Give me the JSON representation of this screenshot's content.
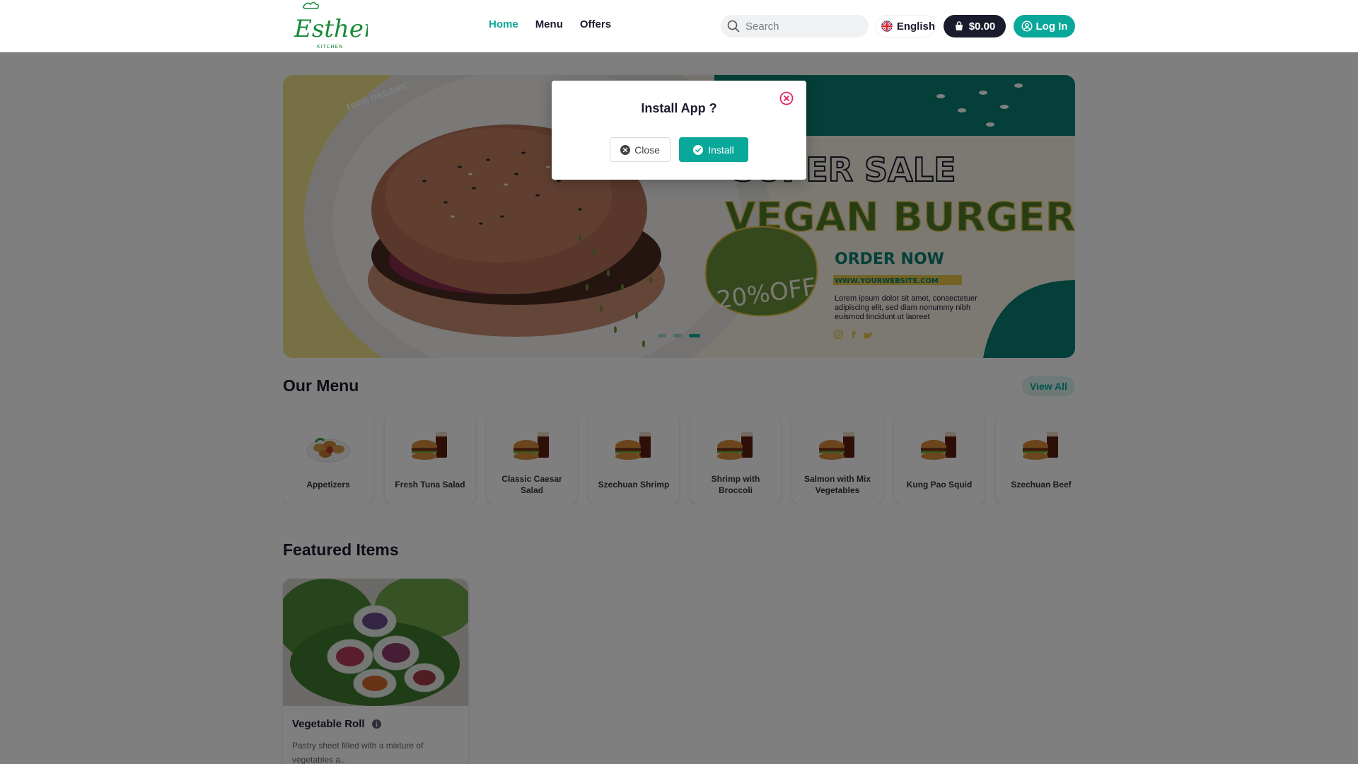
{
  "header": {
    "logo_text": "Esther's",
    "logo_subtext": "KITCHEN",
    "nav": [
      {
        "label": "Home",
        "active": true
      },
      {
        "label": "Menu",
        "active": false
      },
      {
        "label": "Offers",
        "active": false
      }
    ],
    "search_placeholder": "Search",
    "language": "English",
    "cart_total": "$0.00",
    "login_label": "Log In"
  },
  "banner": {
    "badge_text": "100% ORGANIC",
    "headline_1": "SUPER SALE",
    "headline_2": "VEGAN BURGER",
    "cta": "ORDER NOW",
    "website": "WWW.YOURWEBSITE.COM",
    "body_text": "Lorem ipsum dolor sit amet, consectetuer adipiscing elit, sed diam nonummy nibh euismod tincidunt ut laoreet",
    "discount": "20%OFF",
    "carousel_dots": 3,
    "active_dot": 3
  },
  "menu": {
    "title": "Our Menu",
    "view_all": "View All",
    "categories": [
      "Appetizers",
      "Fresh Tuna Salad",
      "Classic Caesar Salad",
      "Szechuan Shrimp",
      "Shrimp with Broccoli",
      "Salmon with Mix Vegetables",
      "Kung Pao Squid",
      "Szechuan Beef"
    ]
  },
  "featured": {
    "title": "Featured Items",
    "items": [
      {
        "name": "Vegetable Roll",
        "description": "Pastry sheet filled with a mixture of vegetables a.."
      }
    ]
  },
  "modal": {
    "title": "Install App ?",
    "close_label": "Close",
    "install_label": "Install"
  },
  "colors": {
    "accent": "#0aa89a",
    "dark": "#1b1b2e",
    "banner_teal": "#0b7f72",
    "banner_green": "#6b8e3a",
    "close_icon": "#e0245e"
  }
}
